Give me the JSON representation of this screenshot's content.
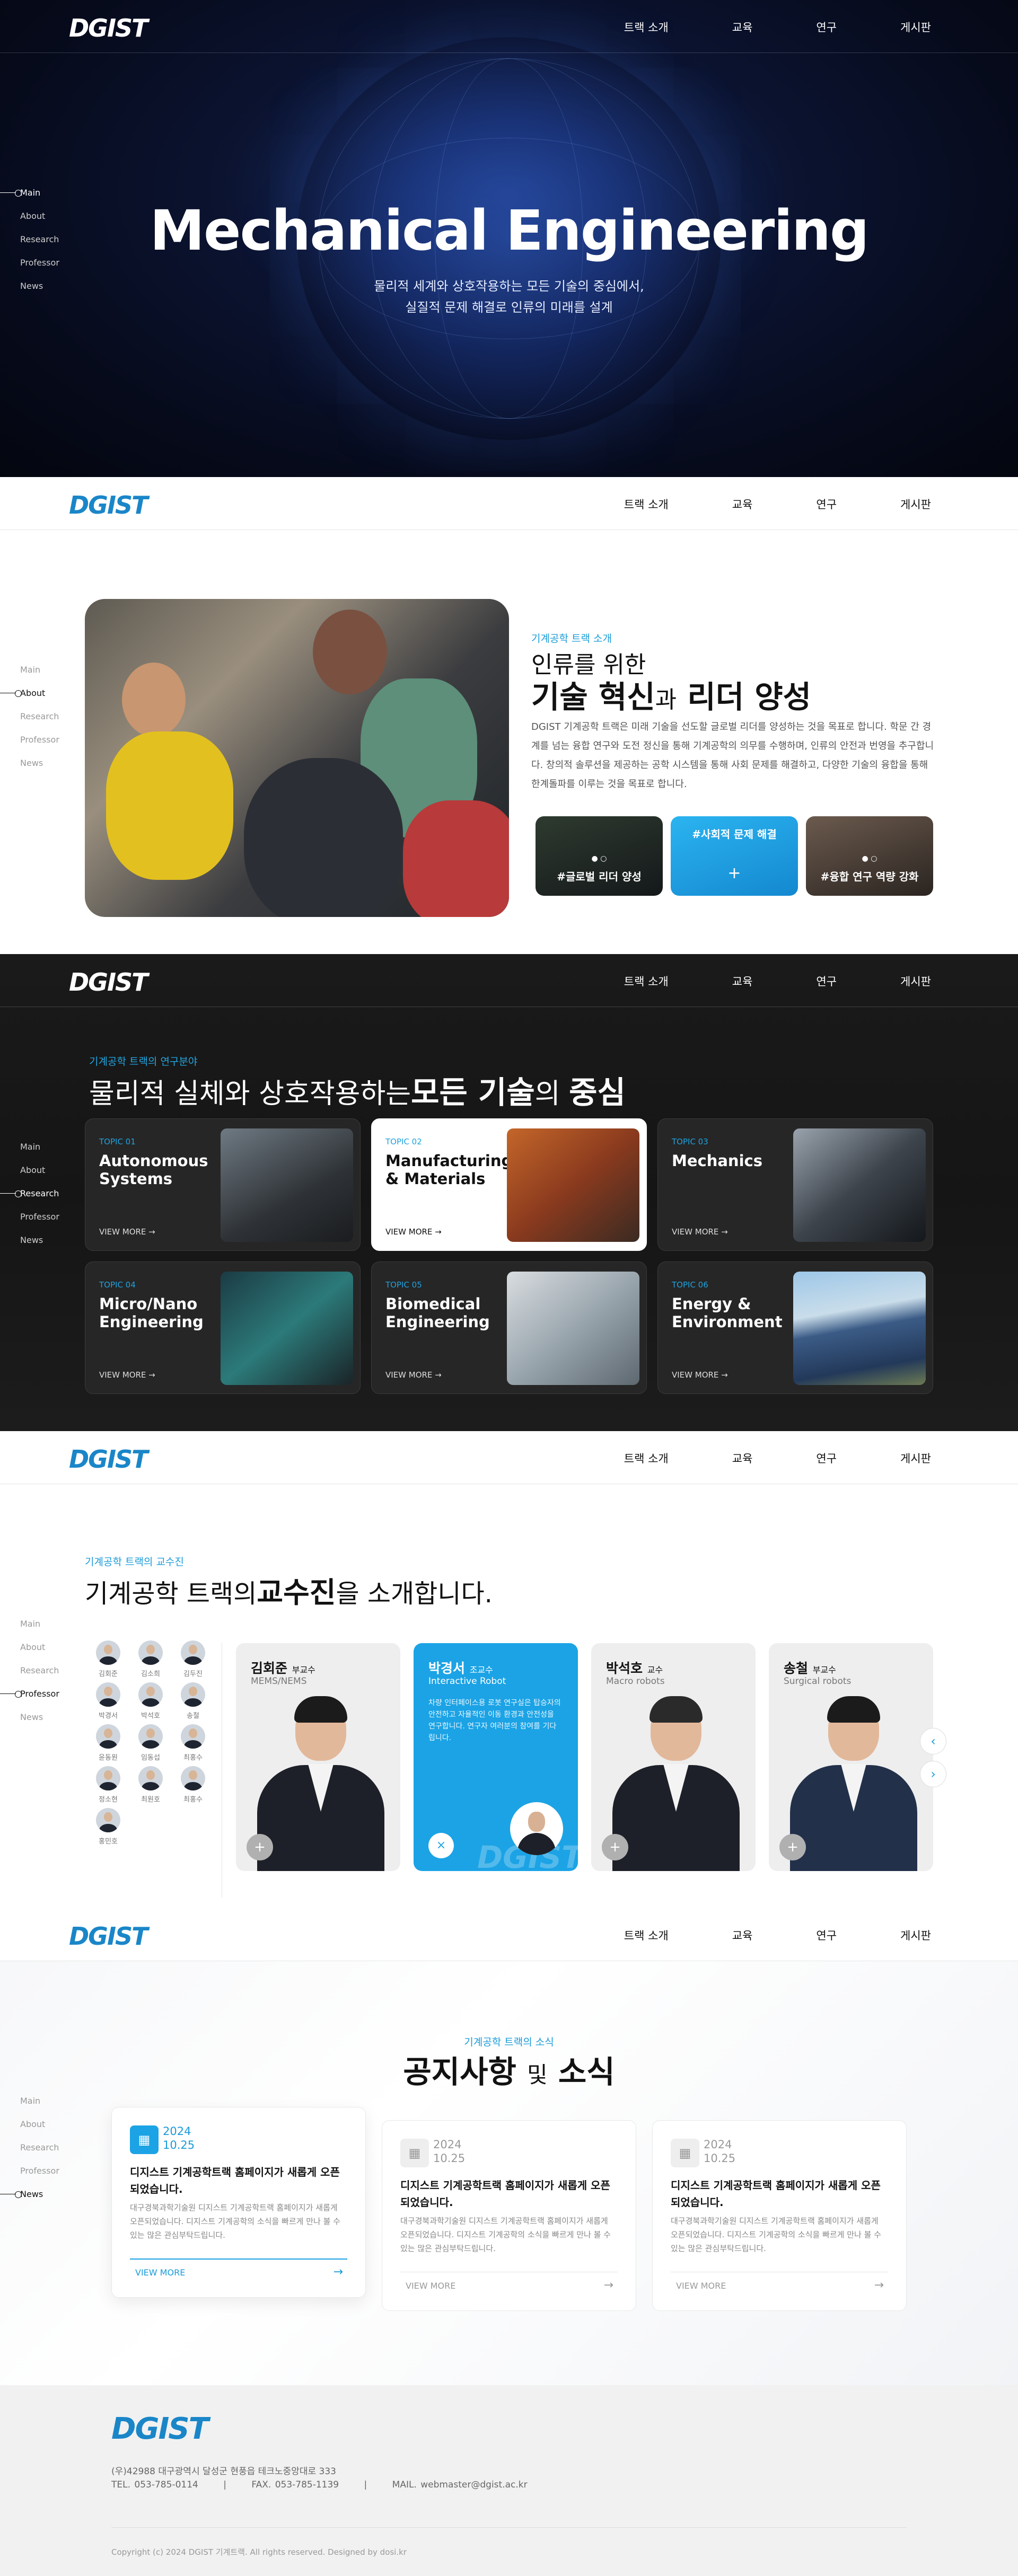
{
  "brand": {
    "logo": "DGIST",
    "accent": "#1ba3e5",
    "dark": "#1a1a1a"
  },
  "nav": {
    "items": [
      "트랙 소개",
      "교육",
      "연구",
      "게시판"
    ]
  },
  "side_nav": {
    "items": [
      "Main",
      "About",
      "Research",
      "Professor",
      "News"
    ]
  },
  "hero": {
    "title": "Mechanical Engineering",
    "sub1": "물리적 세계와 상호작용하는 모든 기술의 중심에서,",
    "sub2": "실질적 문제 해결로 인류의 미래를 설계"
  },
  "about": {
    "tag": "기계공학 트랙 소개",
    "line1": "인류를 위한",
    "line2a": "기술 혁신",
    "line2b": "과",
    "line2c": "리더 양성",
    "desc": "DGIST 기계공학 트랙은 미래 기술을 선도할 글로벌 리더를 양성하는 것을 목표로 합니다. 학문 간 경계를 넘는 융합 연구와 도전 정신을 통해 기계공학의 의무를 수행하며, 인류의 안전과 번영을 추구합니다. 창의적 솔루션을 제공하는 공학 시스템을 통해 사회 문제를 해결하고, 다양한 기술의 융합을 통해 한계돌파를 이루는 것을 목표로 합니다.",
    "cards": [
      "#글로벌 리더 양성",
      "#사회적 문제 해결",
      "#융합 연구 역량 강화"
    ]
  },
  "research": {
    "tag": "기계공학 트랙의 연구분야",
    "title_a": "물리적 실체와 상호작용하는",
    "title_b": "모든 기술",
    "title_c": "의",
    "title_d": "중심",
    "view_more": "VIEW MORE →",
    "topics": [
      {
        "num": "TOPIC 01",
        "name": "Autonomous Systems"
      },
      {
        "num": "TOPIC 02",
        "name": "Manufacturing & Materials"
      },
      {
        "num": "TOPIC 03",
        "name": "Mechanics"
      },
      {
        "num": "TOPIC 04",
        "name": "Micro/Nano Engineering"
      },
      {
        "num": "TOPIC 05",
        "name": "Biomedical Engineering"
      },
      {
        "num": "TOPIC 06",
        "name": "Energy & Environment"
      }
    ]
  },
  "professors": {
    "tag": "기계공학 트랙의 교수진",
    "title_a": "기계공학 트랙의",
    "title_b": "교수진",
    "title_c": "을 소개합니다.",
    "thumbs": [
      "김회준",
      "김소희",
      "김두진",
      "박경서",
      "박석호",
      "송철",
      "윤동원",
      "임동섭",
      "최홍수",
      "정소현",
      "최원호",
      "최홍수",
      "홍민호"
    ],
    "cards": [
      {
        "name": "김회준",
        "title": "부교수",
        "field": "MEMS/NEMS"
      },
      {
        "name": "박경서",
        "title": "조교수",
        "field": "Interactive Robot",
        "desc": "차량 인터페이스용 로봇 연구실은 탑승자의 안전하고 자율적인 이동 환경과 안전성을 연구합니다. 연구자 여러분의 참여를 기다립니다."
      },
      {
        "name": "박석호",
        "title": "교수",
        "field": "Macro robots"
      },
      {
        "name": "송철",
        "title": "부교수",
        "field": "Surgical robots"
      }
    ],
    "arrows": [
      "‹",
      "›"
    ]
  },
  "news": {
    "tag": "기계공학 트랙의 소식",
    "title_a": "공지사항",
    "title_b": "및",
    "title_c": "소식",
    "view_more": "VIEW MORE",
    "items": [
      {
        "year": "2024",
        "date": "10.25",
        "title": "디지스트 기계공학트랙 홈페이지가 새롭게 오픈되었습니다.",
        "body": "대구경북과학기술원 디지스트 기계공학트랙 홈페이지가 새롭게 오픈되었습니다. 디지스트 기계공학의 소식을 빠르게 만나 볼 수 있는 많은 관심부탁드립니다."
      },
      {
        "year": "2024",
        "date": "10.25",
        "title": "디지스트 기계공학트랙 홈페이지가 새롭게 오픈되었습니다.",
        "body": "대구경북과학기술원 디지스트 기계공학트랙 홈페이지가 새롭게 오픈되었습니다. 디지스트 기계공학의 소식을 빠르게 만나 볼 수 있는 많은 관심부탁드립니다."
      },
      {
        "year": "2024",
        "date": "10.25",
        "title": "디지스트 기계공학트랙 홈페이지가 새롭게 오픈되었습니다.",
        "body": "대구경북과학기술원 디지스트 기계공학트랙 홈페이지가 새롭게 오픈되었습니다. 디지스트 기계공학의 소식을 빠르게 만나 볼 수 있는 많은 관심부탁드립니다."
      }
    ]
  },
  "footer": {
    "address": "(우)42988 대구광역시 달성군 현풍읍 테크노중앙대로 333",
    "tel": "TEL. 053-785-0114",
    "fax": "FAX. 053-785-1139",
    "mail": "MAIL. webmaster@dgist.ac.kr",
    "sep": "|",
    "copyright": "Copyright (c) 2024 DGIST 기계트랙. All rights reserved. Designed by dosi.kr"
  }
}
